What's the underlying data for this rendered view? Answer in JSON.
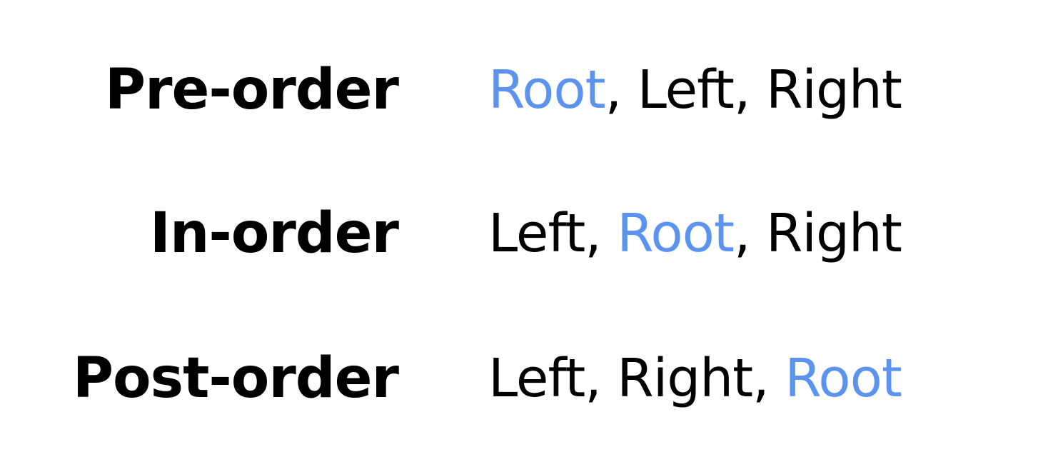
{
  "colors": {
    "text": "#000000",
    "highlight": "#5b93ef",
    "background": "#ffffff"
  },
  "rows": [
    {
      "label": "Pre-order",
      "steps": [
        "Root",
        "Left",
        "Right"
      ],
      "highlight_index": 0,
      "separator": ", "
    },
    {
      "label": "In-order",
      "steps": [
        "Left",
        "Root",
        "Right"
      ],
      "highlight_index": 1,
      "separator": ", "
    },
    {
      "label": "Post-order",
      "steps": [
        "Left",
        "Right",
        "Root"
      ],
      "highlight_index": 2,
      "separator": ", "
    }
  ]
}
